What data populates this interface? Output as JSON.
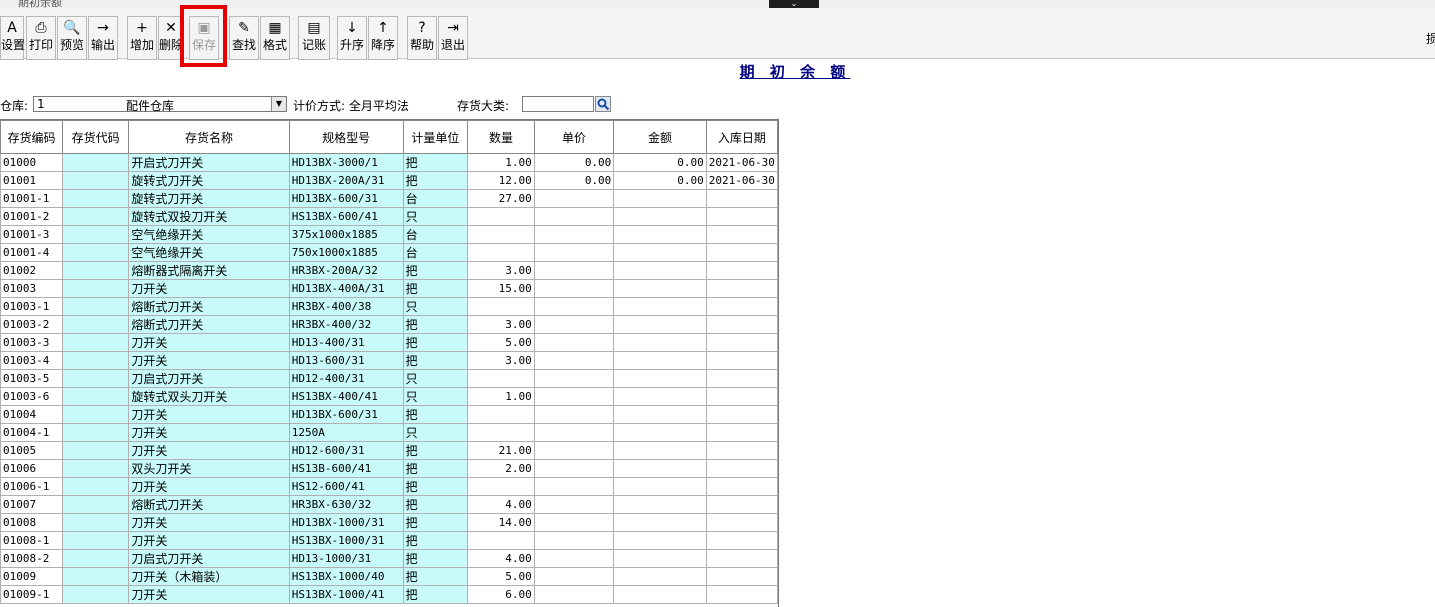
{
  "window": {
    "title": "期初余额",
    "collapse_glyph": "⌄"
  },
  "toolbar": {
    "buttons": [
      {
        "label": "设置",
        "icon": "A"
      },
      {
        "label": "打印",
        "icon": "⎙"
      },
      {
        "label": "预览",
        "icon": "🔍"
      },
      {
        "label": "输出",
        "icon": "→"
      },
      {
        "label": "增加",
        "icon": "+"
      },
      {
        "label": "删除",
        "icon": "✕"
      },
      {
        "label": "保存",
        "icon": "▣"
      },
      {
        "label": "查找",
        "icon": "✎"
      },
      {
        "label": "格式",
        "icon": "▦"
      },
      {
        "label": "记账",
        "icon": "▤"
      },
      {
        "label": "升序",
        "icon": "↓"
      },
      {
        "label": "降序",
        "icon": "↑"
      },
      {
        "label": "帮助",
        "icon": "?"
      },
      {
        "label": "退出",
        "icon": "⇥"
      }
    ],
    "right_char": "损"
  },
  "page_title": "期 初 余 额",
  "filters": {
    "warehouse_label": "仓库:",
    "warehouse_code": "1",
    "warehouse_name": "配件仓库",
    "pricing_label": "计价方式: 全月平均法",
    "category_label": "存货大类:",
    "category_value": ""
  },
  "table": {
    "headers": [
      "存货编码",
      "存货代码",
      "存货名称",
      "规格型号",
      "计量单位",
      "数量",
      "单价",
      "金额",
      "入库日期"
    ],
    "rows": [
      [
        "01000",
        "",
        "开启式刀开关",
        "HD13BX-3000/1",
        "把",
        "1.00",
        "0.00",
        "0.00",
        "2021-06-30"
      ],
      [
        "01001",
        "",
        "旋转式刀开关",
        "HD13BX-200A/31",
        "把",
        "12.00",
        "0.00",
        "0.00",
        "2021-06-30"
      ],
      [
        "01001-1",
        "",
        "旋转式刀开关",
        "HD13BX-600/31",
        "台",
        "27.00",
        "",
        "",
        ""
      ],
      [
        "01001-2",
        "",
        "旋转式双投刀开关",
        "HS13BX-600/41",
        "只",
        "",
        "",
        "",
        ""
      ],
      [
        "01001-3",
        "",
        "空气绝缘开关",
        "375x1000x1885",
        "台",
        "",
        "",
        "",
        ""
      ],
      [
        "01001-4",
        "",
        "空气绝缘开关",
        "750x1000x1885",
        "台",
        "",
        "",
        "",
        ""
      ],
      [
        "01002",
        "",
        "熔断器式隔离开关",
        "HR3BX-200A/32",
        "把",
        "3.00",
        "",
        "",
        ""
      ],
      [
        "01003",
        "",
        "刀开关",
        "HD13BX-400A/31",
        "把",
        "15.00",
        "",
        "",
        ""
      ],
      [
        "01003-1",
        "",
        "熔断式刀开关",
        "HR3BX-400/38",
        "只",
        "",
        "",
        "",
        ""
      ],
      [
        "01003-2",
        "",
        "熔断式刀开关",
        "HR3BX-400/32",
        "把",
        "3.00",
        "",
        "",
        ""
      ],
      [
        "01003-3",
        "",
        "刀开关",
        "HD13-400/31",
        "把",
        "5.00",
        "",
        "",
        ""
      ],
      [
        "01003-4",
        "",
        "刀开关",
        "HD13-600/31",
        "把",
        "3.00",
        "",
        "",
        ""
      ],
      [
        "01003-5",
        "",
        "刀启式刀开关",
        "HD12-400/31",
        "只",
        "",
        "",
        "",
        ""
      ],
      [
        "01003-6",
        "",
        "旋转式双头刀开关",
        "HS13BX-400/41",
        "只",
        "1.00",
        "",
        "",
        ""
      ],
      [
        "01004",
        "",
        "刀开关",
        "HD13BX-600/31",
        "把",
        "",
        "",
        "",
        ""
      ],
      [
        "01004-1",
        "",
        "刀开关",
        "1250A",
        "只",
        "",
        "",
        "",
        ""
      ],
      [
        "01005",
        "",
        "刀开关",
        "HD12-600/31",
        "把",
        "21.00",
        "",
        "",
        ""
      ],
      [
        "01006",
        "",
        "双头刀开关",
        "HS13B-600/41",
        "把",
        "2.00",
        "",
        "",
        ""
      ],
      [
        "01006-1",
        "",
        "刀开关",
        "HS12-600/41",
        "把",
        "",
        "",
        "",
        ""
      ],
      [
        "01007",
        "",
        "熔断式刀开关",
        "HR3BX-630/32",
        "把",
        "4.00",
        "",
        "",
        ""
      ],
      [
        "01008",
        "",
        "刀开关",
        "HD13BX-1000/31",
        "把",
        "14.00",
        "",
        "",
        ""
      ],
      [
        "01008-1",
        "",
        "刀开关",
        "HS13BX-1000/31",
        "把",
        "",
        "",
        "",
        ""
      ],
      [
        "01008-2",
        "",
        "刀启式刀开关",
        "HD13-1000/31",
        "把",
        "4.00",
        "",
        "",
        ""
      ],
      [
        "01009",
        "",
        "刀开关（木箱装）",
        "HS13BX-1000/40",
        "把",
        "5.00",
        "",
        "",
        ""
      ],
      [
        "01009-1",
        "",
        "刀开关",
        "HS13BX-1000/41",
        "把",
        "6.00",
        "",
        "",
        ""
      ]
    ]
  },
  "colors": {
    "highlight": "#e60000",
    "cyan_column": "#c8fafa",
    "title_navy": "#000080"
  }
}
